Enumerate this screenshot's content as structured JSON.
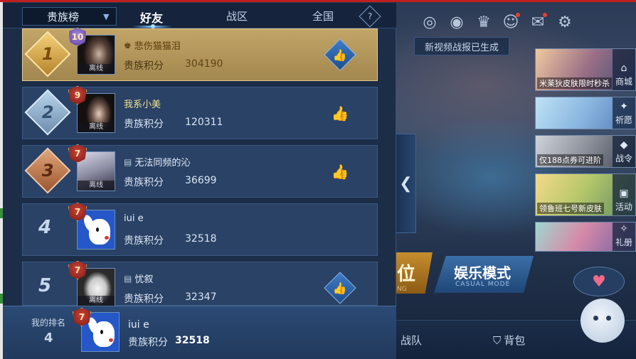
{
  "topbar": {
    "icons": [
      "target-icon",
      "eye-icon",
      "trophy-icon",
      "friends-icon",
      "mail-icon",
      "gear-icon"
    ],
    "tooltip": "新视频战报已生成"
  },
  "panel": {
    "dropdown_label": "贵族榜",
    "tabs": [
      {
        "label": "好友",
        "active": true
      },
      {
        "label": "战区",
        "active": false
      },
      {
        "label": "全国",
        "active": false
      }
    ],
    "help_label": "?",
    "offline_label": "离线",
    "score_label": "贵族积分",
    "rows": [
      {
        "rank": "1",
        "vip": "10",
        "name": "悲伤猫猫泪",
        "score": "304190",
        "offline": true
      },
      {
        "rank": "2",
        "vip": "9",
        "name": "我系小美",
        "score": "120311",
        "offline": true
      },
      {
        "rank": "3",
        "vip": "7",
        "name": "无法同频的沁",
        "score": "36699",
        "offline": true
      },
      {
        "rank": "4",
        "vip": "7",
        "name": "iui e",
        "score": "32518",
        "offline": false
      },
      {
        "rank": "5",
        "vip": "7",
        "name": "忧叙",
        "score": "32347",
        "offline": true
      }
    ],
    "my_rank": {
      "label": "我的排名",
      "rank": "4",
      "vip": "7",
      "name": "iui e",
      "score_label": "贵族积分",
      "score": "32518"
    }
  },
  "right_banners": [
    {
      "caption": "米莱狄皮肤限时秒杀",
      "side_label": "商城"
    },
    {
      "caption": "",
      "side_label": "祈愿"
    },
    {
      "caption": "仅188点券可进阶",
      "side_label": "战令"
    },
    {
      "caption": "领鲁班七号新皮肤",
      "side_label": "活动"
    },
    {
      "caption": "",
      "side_label": "礼册"
    }
  ],
  "modes": {
    "ranked_label": "位",
    "ranked_sub": "NG",
    "casual_label": "娱乐模式",
    "casual_sub": "CASUAL MODE"
  },
  "bottom_nav": {
    "team_label": "战队",
    "bag_label": "背包"
  }
}
